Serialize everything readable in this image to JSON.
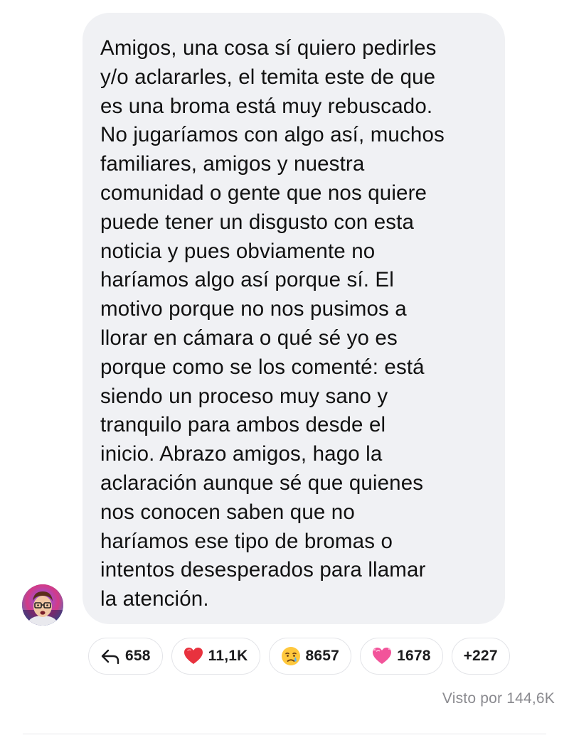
{
  "message": {
    "lines": [
      "Amigos, una cosa sí quiero pedirles",
      "y/o aclararles, el temita este de que",
      "es una broma está muy rebuscado.",
      "No jugaríamos con algo así, muchos",
      "familiares, amigos y nuestra",
      "comunidad o gente que nos quiere",
      "puede tener un disgusto con esta",
      "noticia y pues obviamente no",
      "haríamos algo así porque sí. El",
      "motivo porque no nos pusimos a",
      "llorar en cámara o qué sé yo es",
      "porque como se los comenté: está",
      "siendo un proceso muy sano y",
      "tranquilo para ambos desde el",
      "inicio. Abrazo amigos, hago la",
      "aclaración aunque sé que quienes",
      "nos conocen saben que no",
      "haríamos ese tipo de bromas o",
      "intentos desesperados para llamar",
      "la atención."
    ]
  },
  "reactions": [
    {
      "icon": "reply-arrow-icon",
      "count": "658"
    },
    {
      "icon": "red-heart-icon",
      "count": "11,1K"
    },
    {
      "icon": "crying-face-icon",
      "count": "8657"
    },
    {
      "icon": "pink-heart-icon",
      "count": "1678"
    },
    {
      "icon": "",
      "count": "+227"
    }
  ],
  "seen_by": "Visto por 144,6K",
  "colors": {
    "bubble_background": "#f0f1f4",
    "chip_border": "#e3e4e8",
    "seen_text": "#8a8a8f",
    "red_heart": "#e8323e",
    "pink_heart": "#f2549a"
  }
}
